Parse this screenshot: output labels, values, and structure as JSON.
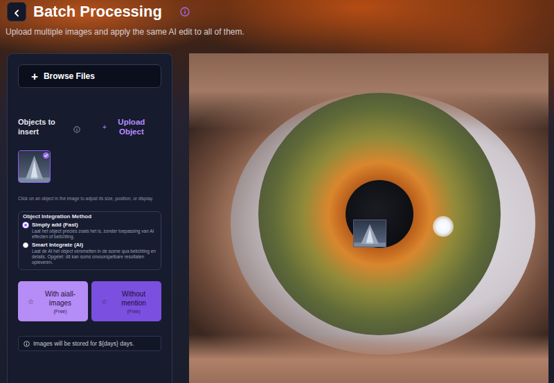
{
  "header": {
    "title": "Batch Processing",
    "subtitle": "Upload multiple images and apply the same AI edit to all of them."
  },
  "browse": {
    "icon": "+",
    "label": "Browse Files"
  },
  "objects": {
    "label": "Objects to insert",
    "upload_icon": "+",
    "upload_label": "Upload Object",
    "items": [
      {
        "selected": true
      }
    ]
  },
  "hint": "Click on an object in the image to adjust its size, position, or display.",
  "integration": {
    "title": "Object Integration Method",
    "options": [
      {
        "label": "Simply add (Fast)",
        "description": "Laat het object precies zoals het is, zonder toepassing van AI effecten of belichting.",
        "selected": true
      },
      {
        "label": "Smart Integrate (AI)",
        "description": "Laat de AI het object versmelten in de scene qua belichting en details. Opgelet: dit kan soms onvoorspelbare resultaten opleveren.",
        "selected": false
      }
    ]
  },
  "actions": [
    {
      "icon": "☆",
      "label": "With aiall-images",
      "price": "(Free)",
      "kind": "light"
    },
    {
      "icon": "☆",
      "label": "Without mention",
      "price": "(Free)",
      "kind": "dark"
    }
  ],
  "note": "Images will be stored for ${days} days."
}
